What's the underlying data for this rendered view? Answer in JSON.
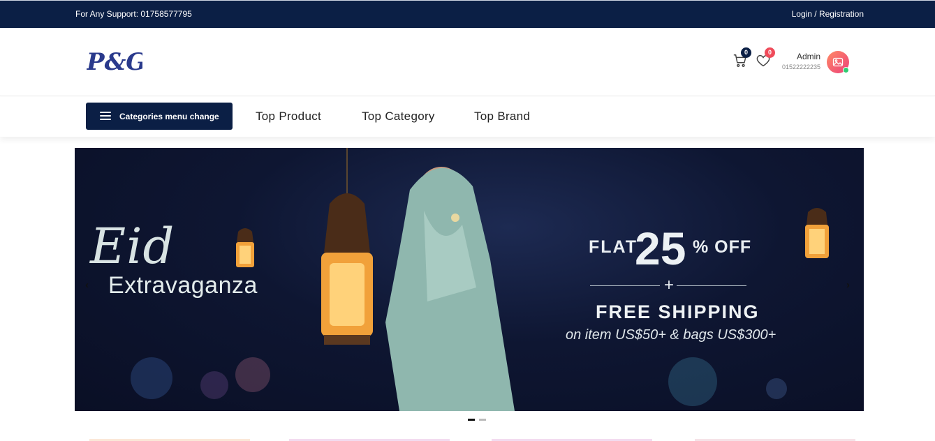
{
  "topbar": {
    "support_text": "For Any Support: 01758577795",
    "login_text": "Login / Registration"
  },
  "header": {
    "logo_text": "P&G",
    "cart_count": "0",
    "wishlist_count": "0",
    "user_name": "Admin",
    "user_phone": "01522222235"
  },
  "nav": {
    "categories_button": "Categories menu change",
    "links": [
      "Top Product",
      "Top Category",
      "Top Brand"
    ]
  },
  "banner": {
    "eid": "Eid",
    "extravaganza": "Extravaganza",
    "flat": "FLAT",
    "percent": "25",
    "off": "% OFF",
    "plus": "+",
    "free_shipping": "FREE SHIPPING",
    "condition": "on item US$50+ & bags US$300+",
    "prev_arrow": "‹",
    "next_arrow": "›",
    "active_slide": 1,
    "slide_count": 2
  },
  "colors": {
    "navy": "#0b1f45",
    "wish_badge": "#ef4b5a",
    "online": "#2ecc71"
  }
}
